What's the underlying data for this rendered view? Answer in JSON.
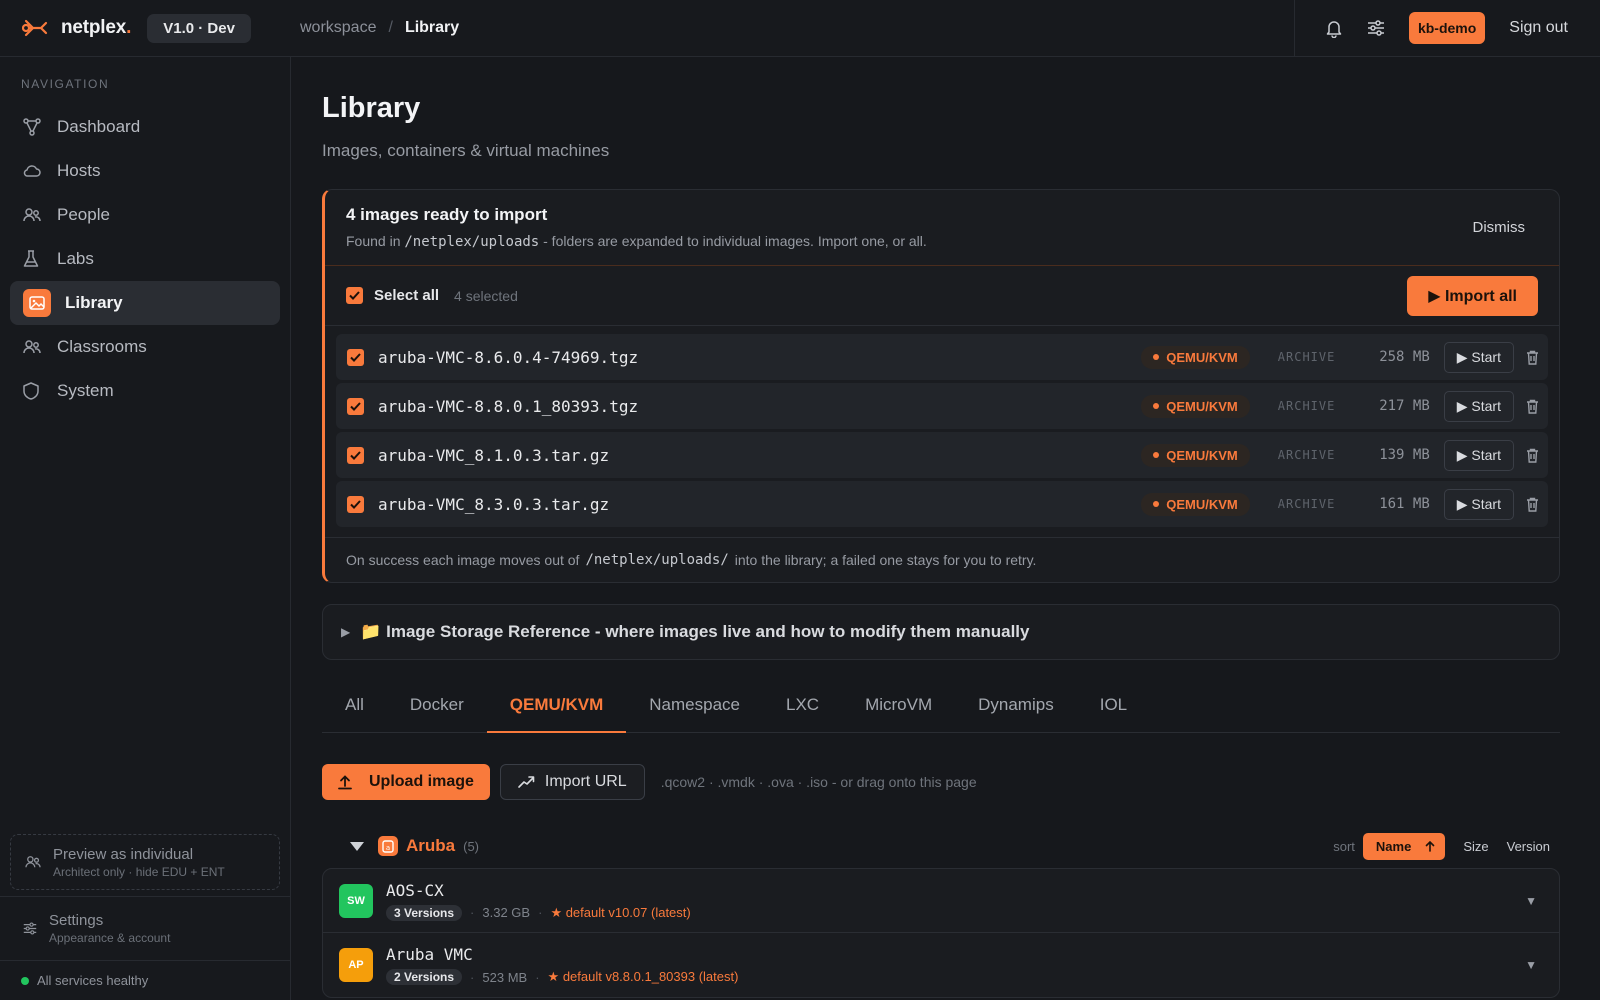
{
  "brand": {
    "name": "netplex",
    "dot": ".",
    "version": "V1.0 · Dev"
  },
  "breadcrumb": {
    "root": "workspace",
    "separator": "/",
    "current": "Library"
  },
  "topbar": {
    "user": "kb-demo",
    "sign_out": "Sign out"
  },
  "sidebar": {
    "heading": "NAVIGATION",
    "items": [
      {
        "label": "Dashboard",
        "icon": "dashboard-icon"
      },
      {
        "label": "Hosts",
        "icon": "cloud-icon"
      },
      {
        "label": "People",
        "icon": "people-icon"
      },
      {
        "label": "Labs",
        "icon": "flask-icon"
      },
      {
        "label": "Library",
        "icon": "image-icon",
        "active": true
      },
      {
        "label": "Classrooms",
        "icon": "people-icon"
      },
      {
        "label": "System",
        "icon": "shield-icon"
      }
    ],
    "preview": {
      "title": "Preview as individual",
      "subtitle": "Architect only · hide EDU + ENT"
    },
    "settings": {
      "title": "Settings",
      "subtitle": "Appearance & account"
    },
    "health": "All services healthy"
  },
  "page": {
    "title": "Library",
    "subtitle": "Images, containers & virtual machines"
  },
  "import_card": {
    "title": "4 images ready to import",
    "desc_prefix": "Found in",
    "desc_path": "/netplex/uploads",
    "desc_suffix": "- folders are expanded to individual images. Import one, or all.",
    "dismiss": "Dismiss",
    "select_all": "Select all",
    "selected_count": "4 selected",
    "import_all": "▶ Import all",
    "files": [
      {
        "name": "aruba-VMC-8.6.0.4-74969.tgz",
        "type": "QEMU/KVM",
        "kind": "ARCHIVE",
        "size": "258 MB",
        "action": "▶ Start"
      },
      {
        "name": "aruba-VMC-8.8.0.1_80393.tgz",
        "type": "QEMU/KVM",
        "kind": "ARCHIVE",
        "size": "217 MB",
        "action": "▶ Start"
      },
      {
        "name": "aruba-VMC_8.1.0.3.tar.gz",
        "type": "QEMU/KVM",
        "kind": "ARCHIVE",
        "size": "139 MB",
        "action": "▶ Start"
      },
      {
        "name": "aruba-VMC_8.3.0.3.tar.gz",
        "type": "QEMU/KVM",
        "kind": "ARCHIVE",
        "size": "161 MB",
        "action": "▶ Start"
      }
    ],
    "footer_prefix": "On success each image moves out of",
    "footer_path": "/netplex/uploads/",
    "footer_suffix": "into the library; a failed one stays for you to retry."
  },
  "storage_reference": {
    "caret": "▶",
    "label": "📁 Image Storage Reference - where images live and how to modify them manually"
  },
  "tabs": [
    {
      "label": "All"
    },
    {
      "label": "Docker"
    },
    {
      "label": "QEMU/KVM",
      "active": true
    },
    {
      "label": "Namespace"
    },
    {
      "label": "LXC"
    },
    {
      "label": "MicroVM"
    },
    {
      "label": "Dynamips"
    },
    {
      "label": "IOL"
    }
  ],
  "actions": {
    "upload": "Upload image",
    "import_url": "Import URL",
    "hint": ".qcow2 · .vmdk · .ova · .iso - or drag onto this page"
  },
  "group": {
    "name": "Aruba",
    "count": "(5)",
    "sort_label": "sort",
    "sort_active": "Name",
    "sort_options": [
      "Size",
      "Version"
    ]
  },
  "images": [
    {
      "avatar": "SW",
      "avatar_color": "#22c55e",
      "name": "AOS-CX",
      "versions": "3 Versions",
      "size": "3.32 GB",
      "default": "★ default v10.07 (latest)"
    },
    {
      "avatar": "AP",
      "avatar_color": "#f59e0b",
      "name": "Aruba VMC",
      "versions": "2 Versions",
      "size": "523 MB",
      "default": "★ default v8.8.0.1_80393 (latest)"
    }
  ],
  "colors": {
    "accent": "#f97a3c",
    "bg": "#16181c",
    "panel": "#1a1c20",
    "healthy": "#22c55e"
  }
}
